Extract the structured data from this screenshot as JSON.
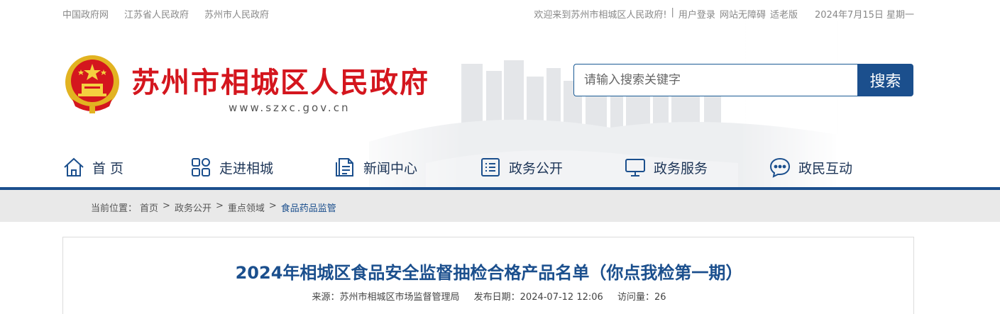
{
  "topbar": {
    "links": [
      "中国政府网",
      "江苏省人民政府",
      "苏州市人民政府"
    ],
    "welcome": "欢迎来到苏州市相城区人民政府!",
    "sep": "|",
    "login": "用户登录",
    "accessibility": "网站无障碍",
    "elderly": "适老版",
    "date": "2024年7月15日 星期一"
  },
  "brand": {
    "title": "苏州市相城区人民政府",
    "url": "www.szxc.gov.cn",
    "primary_color": "#d4161e",
    "accent_color": "#1b4f8d"
  },
  "search": {
    "placeholder": "请输入搜索关键字",
    "button": "搜索"
  },
  "nav": {
    "items": [
      {
        "label": "首 页",
        "icon": "home-icon"
      },
      {
        "label": "走进相城",
        "icon": "grid-icon"
      },
      {
        "label": "新闻中心",
        "icon": "document-icon"
      },
      {
        "label": "政务公开",
        "icon": "list-icon"
      },
      {
        "label": "政务服务",
        "icon": "monitor-icon"
      },
      {
        "label": "政民互动",
        "icon": "chat-icon"
      }
    ]
  },
  "breadcrumb": {
    "prefix": "当前位置：",
    "items": [
      "首页",
      "政务公开",
      "重点领域",
      "食品药品监管"
    ],
    "separator": ">"
  },
  "article": {
    "title": "2024年相城区食品安全监督抽检合格产品名单（你点我检第一期）",
    "source_label": "来源：",
    "source": "苏州市相城区市场监督管理局",
    "date_label": "发布日期：",
    "date": "2024-07-12 12:06",
    "views_label": "访问量：",
    "views": "26"
  }
}
